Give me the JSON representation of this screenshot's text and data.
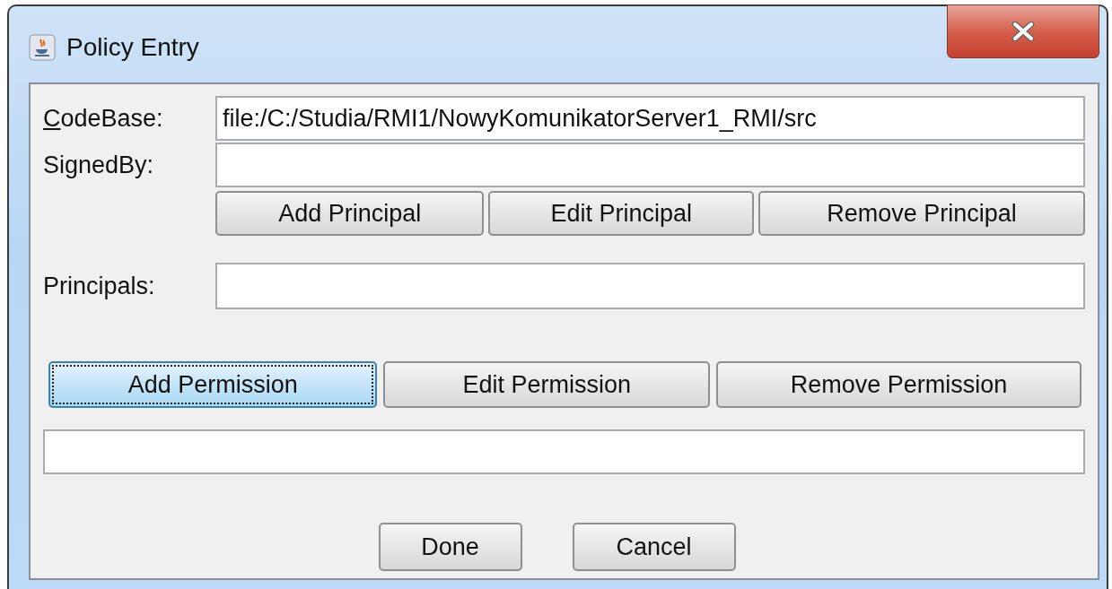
{
  "window": {
    "title": "Policy Entry"
  },
  "fields": [
    {
      "label": "CodeBase:",
      "mnemonic": true,
      "value": "file:/C:/Studia/RMI1/NowyKomunikatorServer1_RMI/src"
    },
    {
      "label": "SignedBy:",
      "mnemonic": false
    }
  ],
  "principal_buttons": [
    {
      "label": "Add Principal",
      "focused": false
    },
    {
      "label": "Edit Principal",
      "focused": false
    },
    {
      "label": "Remove Principal",
      "focused": false
    }
  ],
  "principals": {
    "label": "Principals:"
  },
  "permission_buttons": [
    {
      "label": "Add Permission",
      "focused": true
    },
    {
      "label": "Edit Permission",
      "focused": false
    },
    {
      "label": "Remove Permission",
      "focused": false
    }
  ],
  "dialog_buttons": [
    {
      "label": "Done",
      "focused": false
    },
    {
      "label": "Cancel",
      "focused": false
    }
  ]
}
